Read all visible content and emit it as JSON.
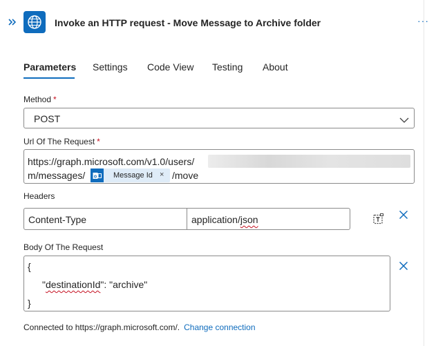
{
  "header": {
    "title": "Invoke an HTTP request - Move Message to Archive folder",
    "expand_icon": "double-chevron-right-icon",
    "app_icon": "globe-icon",
    "more_icon": "more-horizontal-icon",
    "more_label": "···"
  },
  "tabs": [
    {
      "label": "Parameters",
      "active": true
    },
    {
      "label": "Settings",
      "active": false
    },
    {
      "label": "Code View",
      "active": false
    },
    {
      "label": "Testing",
      "active": false
    },
    {
      "label": "About",
      "active": false
    }
  ],
  "method": {
    "label": "Method",
    "required_mark": "*",
    "value": "POST"
  },
  "url": {
    "label": "Url Of The Request",
    "required_mark": "*",
    "line1": "https://graph.microsoft.com/v1.0/users/",
    "line2_prefix": "m/messages/",
    "token_label": "Message Id",
    "token_remove": "×",
    "suffix": "/move"
  },
  "headers": {
    "label": "Headers",
    "key": "Content-Type",
    "value_prefix": "application/",
    "value_squiggle": "json"
  },
  "body": {
    "label": "Body Of The Request",
    "open_brace": "{",
    "line_key_open": "\"",
    "line_key_squiggle": "destinationId",
    "line_rest": "\": \"archive\"",
    "close_brace": "}"
  },
  "footer": {
    "connected_text": "Connected to https://graph.microsoft.com/.",
    "change_link": "Change connection"
  },
  "colors": {
    "accent": "#0f6cbd",
    "required": "#c50f1f",
    "token_bg": "#dfecf8"
  }
}
